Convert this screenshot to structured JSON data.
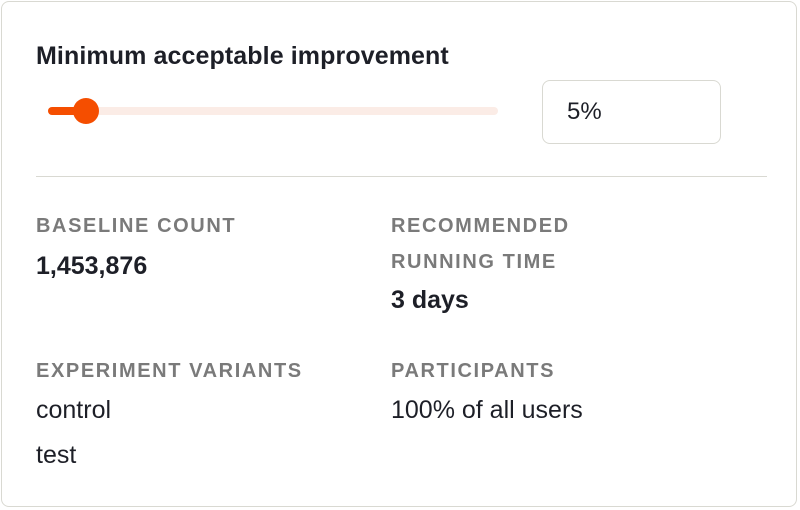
{
  "improvement": {
    "title": "Minimum acceptable improvement",
    "slider_value_fraction": 0.085,
    "input_value": "5%"
  },
  "stats": {
    "baseline_count_label": "BASELINE COUNT",
    "baseline_count_value": "1,453,876",
    "running_time_label_line1": "RECOMMENDED",
    "running_time_label_line2": "RUNNING TIME",
    "running_time_value": "3 days",
    "variants_label": "EXPERIMENT VARIANTS",
    "variants": [
      "control",
      "test"
    ],
    "participants_label": "PARTICIPANTS",
    "participants_value": "100% of all users"
  },
  "colors": {
    "accent": "#f54e00",
    "track": "#fbece6",
    "border": "#d9d9d2",
    "label": "#7a7a7a"
  }
}
